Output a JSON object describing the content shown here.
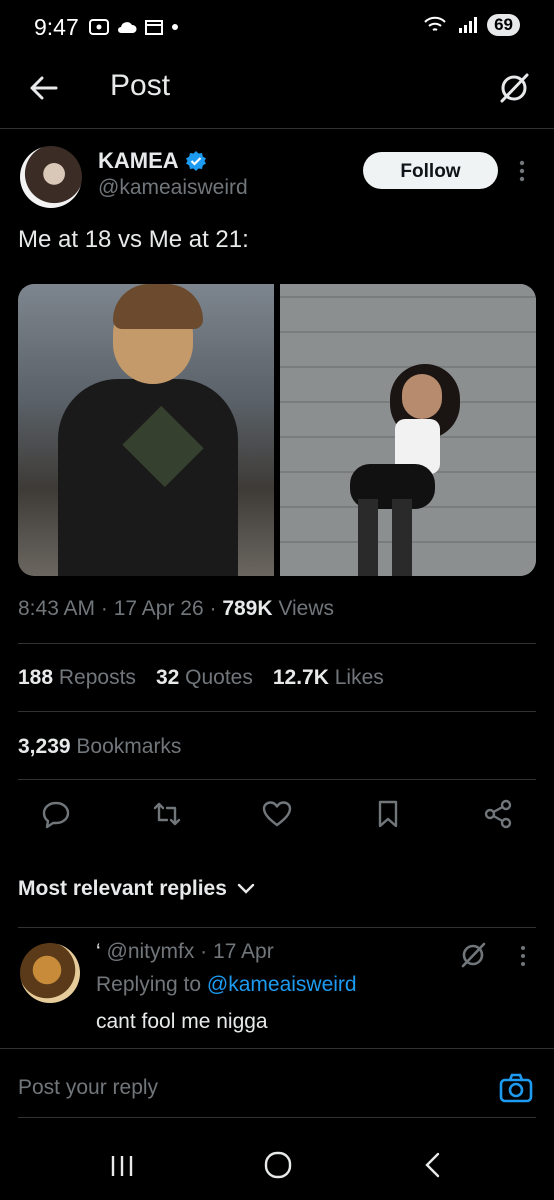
{
  "status_bar": {
    "time": "9:47",
    "battery": "69"
  },
  "header": {
    "title": "Post"
  },
  "author": {
    "name": "KAMEA",
    "handle": "@kameaisweird",
    "follow_label": "Follow"
  },
  "post": {
    "text": "Me at 18 vs Me at 21:",
    "time": "8:43 AM",
    "date": "17 Apr 26",
    "views_count": "789K",
    "views_label": "Views"
  },
  "stats": {
    "reposts_count": "188",
    "reposts_label": "Reposts",
    "quotes_count": "32",
    "quotes_label": "Quotes",
    "likes_count": "12.7K",
    "likes_label": "Likes",
    "bookmarks_count": "3,239",
    "bookmarks_label": "Bookmarks"
  },
  "replies_filter": {
    "label": "Most relevant replies"
  },
  "reply": {
    "prefix": "‘",
    "handle": "@nitymfx",
    "date": "17 Apr",
    "replying_to_label": "Replying to",
    "replying_to_handle": "@kameaisweird",
    "text": "cant fool me nigga"
  },
  "composer": {
    "placeholder": "Post your reply"
  },
  "colors": {
    "background": "#000000",
    "accent": "#1d9bf0",
    "text": "#e7e9ea",
    "muted": "#71767b",
    "divider": "#2f3336"
  },
  "icons": [
    "back-arrow-icon",
    "grok-icon",
    "verified-icon",
    "more-icon",
    "reply-icon",
    "repost-icon",
    "like-icon",
    "bookmark-icon",
    "share-icon",
    "chevron-down-icon",
    "camera-icon"
  ]
}
